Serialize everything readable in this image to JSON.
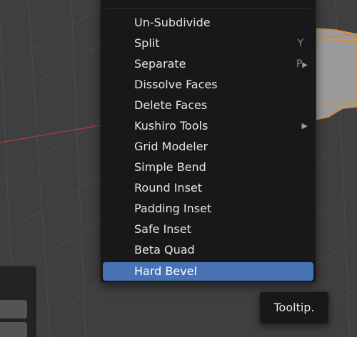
{
  "menu": {
    "items": [
      {
        "label": "Un-Subdivide",
        "shortcut": "",
        "has_submenu": false,
        "active": false
      },
      {
        "label": "Split",
        "shortcut": "Y",
        "has_submenu": false,
        "active": false
      },
      {
        "label": "Separate",
        "shortcut": "P",
        "has_submenu": true,
        "active": false
      },
      {
        "label": "Dissolve Faces",
        "shortcut": "",
        "has_submenu": false,
        "active": false
      },
      {
        "label": "Delete Faces",
        "shortcut": "",
        "has_submenu": false,
        "active": false
      },
      {
        "label": "Kushiro Tools",
        "shortcut": "",
        "has_submenu": true,
        "active": false
      },
      {
        "label": "Grid Modeler",
        "shortcut": "",
        "has_submenu": false,
        "active": false
      },
      {
        "label": "Simple Bend",
        "shortcut": "",
        "has_submenu": false,
        "active": false
      },
      {
        "label": "Round Inset",
        "shortcut": "",
        "has_submenu": false,
        "active": false
      },
      {
        "label": "Padding Inset",
        "shortcut": "",
        "has_submenu": false,
        "active": false
      },
      {
        "label": "Safe Inset",
        "shortcut": "",
        "has_submenu": false,
        "active": false
      },
      {
        "label": "Beta Quad",
        "shortcut": "",
        "has_submenu": false,
        "active": false
      },
      {
        "label": "Hard Bevel",
        "shortcut": "",
        "has_submenu": false,
        "active": true
      }
    ]
  },
  "tooltip": {
    "text": "Tooltip."
  },
  "colors": {
    "viewport_bg": "#3f3f3f",
    "grid_line": "#4a4a4a",
    "axis_x": "#b33a3a",
    "menu_bg": "#181818",
    "highlight": "#4772b3",
    "mesh_face": "#9a9a9a",
    "mesh_edge": "#e8892a"
  }
}
